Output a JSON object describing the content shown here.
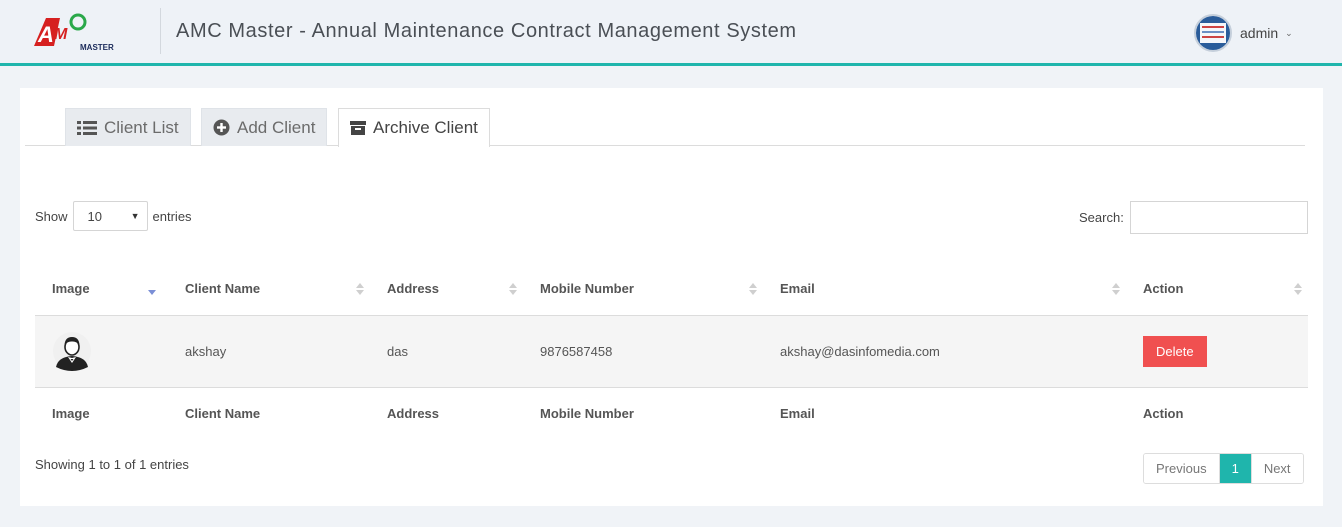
{
  "header": {
    "logo_text": "AMC MASTER",
    "title": "AMC Master - Annual Maintenance Contract Management System",
    "user_name": "admin",
    "accent_color": "#1fb5ac"
  },
  "tabs": [
    {
      "label": "Client List",
      "icon": "list-icon"
    },
    {
      "label": "Add Client",
      "icon": "plus-circle-icon"
    },
    {
      "label": "Archive Client",
      "icon": "archive-icon",
      "active": true
    }
  ],
  "controls": {
    "show_label": "Show",
    "page_size": "10",
    "entries_label": "entries",
    "search_label": "Search:",
    "search_value": ""
  },
  "table": {
    "columns": [
      "Image",
      "Client Name",
      "Address",
      "Mobile Number",
      "Email",
      "Action"
    ],
    "rows": [
      {
        "client_name": "akshay",
        "address": "das",
        "mobile": "9876587458",
        "email": "akshay@dasinfomedia.com",
        "action": "Delete"
      }
    ]
  },
  "footer": {
    "info": "Showing 1 to 1 of 1 entries",
    "prev": "Previous",
    "current_page": "1",
    "next": "Next"
  },
  "colors": {
    "delete": "#f05050",
    "active_page": "#1fb5ac"
  }
}
